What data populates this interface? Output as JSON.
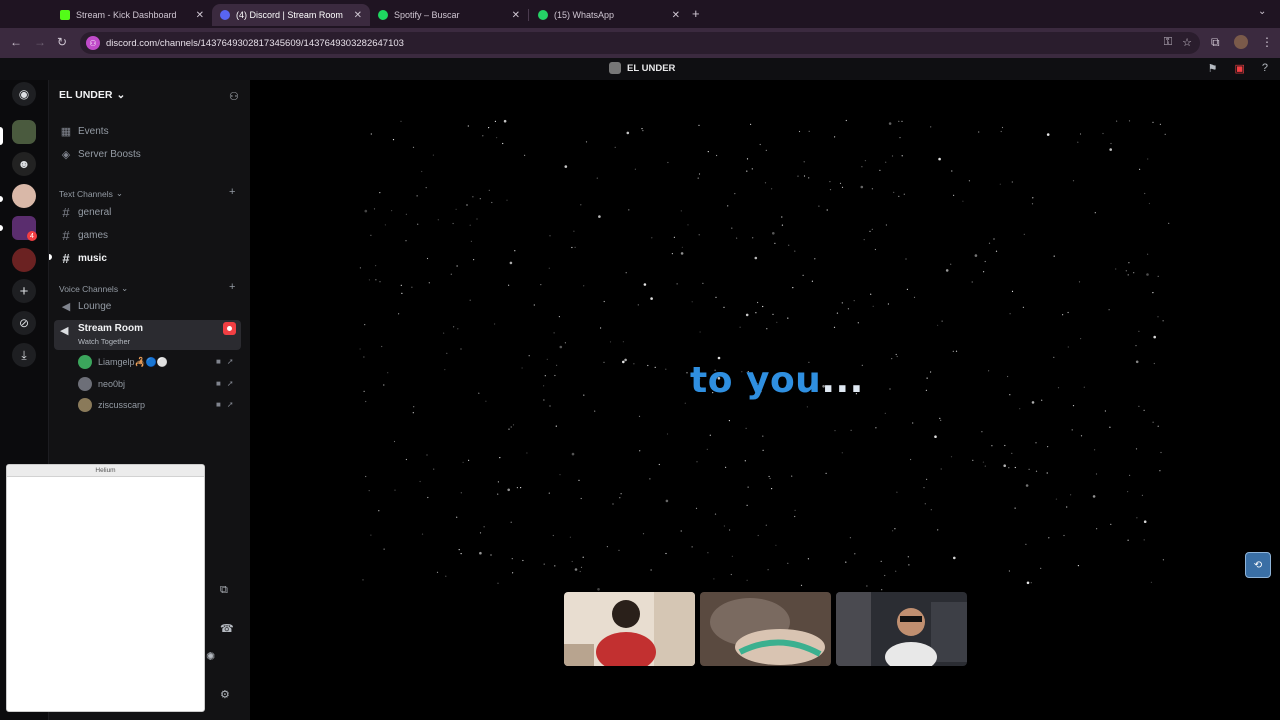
{
  "browser": {
    "tabs": [
      {
        "title": "Stream - Kick Dashboard",
        "favicon_color": "#53fc18",
        "active": false
      },
      {
        "title": "(4) Discord | Stream Room",
        "favicon_color": "#5865f2",
        "active": true
      },
      {
        "title": "Spotify – Buscar",
        "favicon_color": "#1ed760",
        "active": false
      },
      {
        "title": "(15) WhatsApp",
        "favicon_color": "#25d366",
        "active": false
      }
    ],
    "url": "discord.com/channels/1437649302817345609/1437649303282647103"
  },
  "discord": {
    "top_title": "EL UNDER",
    "server_name": "EL UNDER",
    "rail_badge_count": "4",
    "menu": {
      "events": "Events",
      "server_boosts": "Server Boosts"
    },
    "text_category": "Text Channels",
    "text_channels": [
      "general",
      "games",
      "music"
    ],
    "voice_category": "Voice Channels",
    "voice_channels": {
      "lounge": "Lounge",
      "stream_room": "Stream Room",
      "stream_room_activity": "Watch Together"
    },
    "voice_users": [
      "Liamgelp🦂🔵⚪",
      "neo0bj",
      "ziscusscarp"
    ]
  },
  "popup": {
    "title": "Helium"
  },
  "stage": {
    "caption_main": "to you",
    "caption_dots": "..."
  },
  "colors": {
    "accent_blue": "#2f8fe0",
    "live_red": "#f23f43",
    "browser_bg": "#3b2a3f"
  }
}
